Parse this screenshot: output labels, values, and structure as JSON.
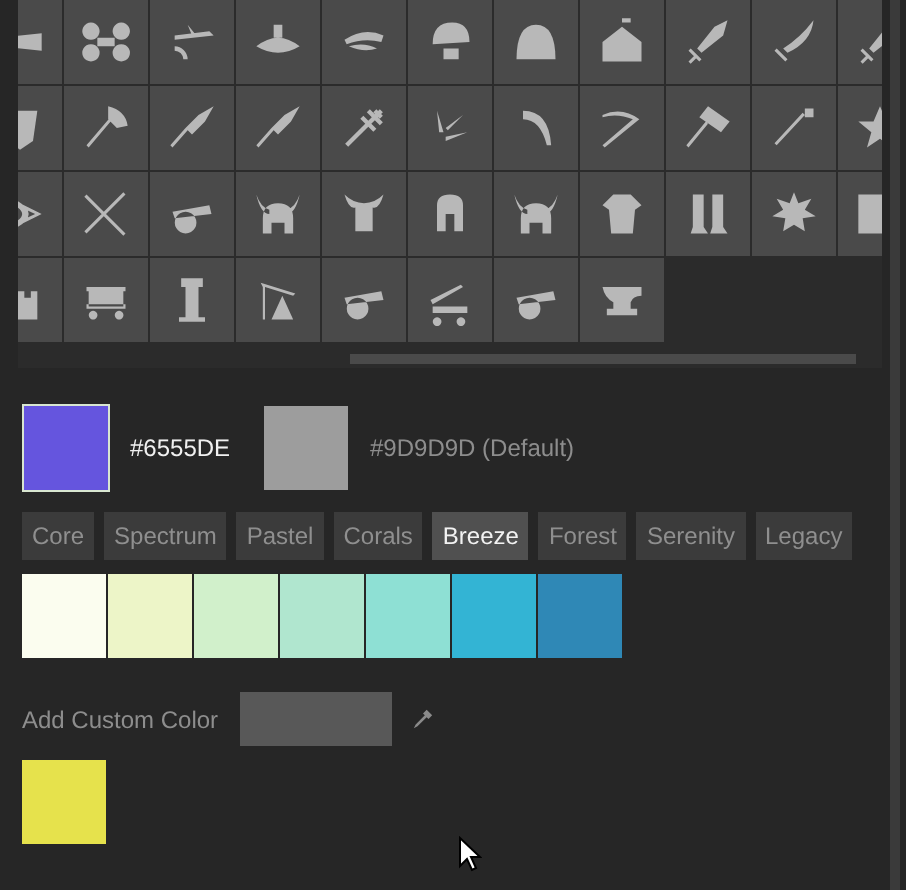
{
  "current_color": {
    "value": "#6555DE",
    "color": "#6555de"
  },
  "default_color": {
    "label": "#9D9D9D (Default)",
    "color": "#9d9d9d"
  },
  "palette_tabs": [
    {
      "label": "Core",
      "selected": false
    },
    {
      "label": "Spectrum",
      "selected": false
    },
    {
      "label": "Pastel",
      "selected": false
    },
    {
      "label": "Corals",
      "selected": false
    },
    {
      "label": "Breeze",
      "selected": true
    },
    {
      "label": "Forest",
      "selected": false
    },
    {
      "label": "Serenity",
      "selected": false
    },
    {
      "label": "Legacy",
      "selected": false
    }
  ],
  "swatches": [
    {
      "color": "#fbfdef"
    },
    {
      "color": "#edf5c8"
    },
    {
      "color": "#d1f0cb"
    },
    {
      "color": "#b0e6cf"
    },
    {
      "color": "#8ee0d4"
    },
    {
      "color": "#33b4d4"
    },
    {
      "color": "#2f88b6"
    }
  ],
  "custom": {
    "label": "Add Custom Color",
    "colors": [
      {
        "color": "#e6e24c"
      }
    ]
  }
}
